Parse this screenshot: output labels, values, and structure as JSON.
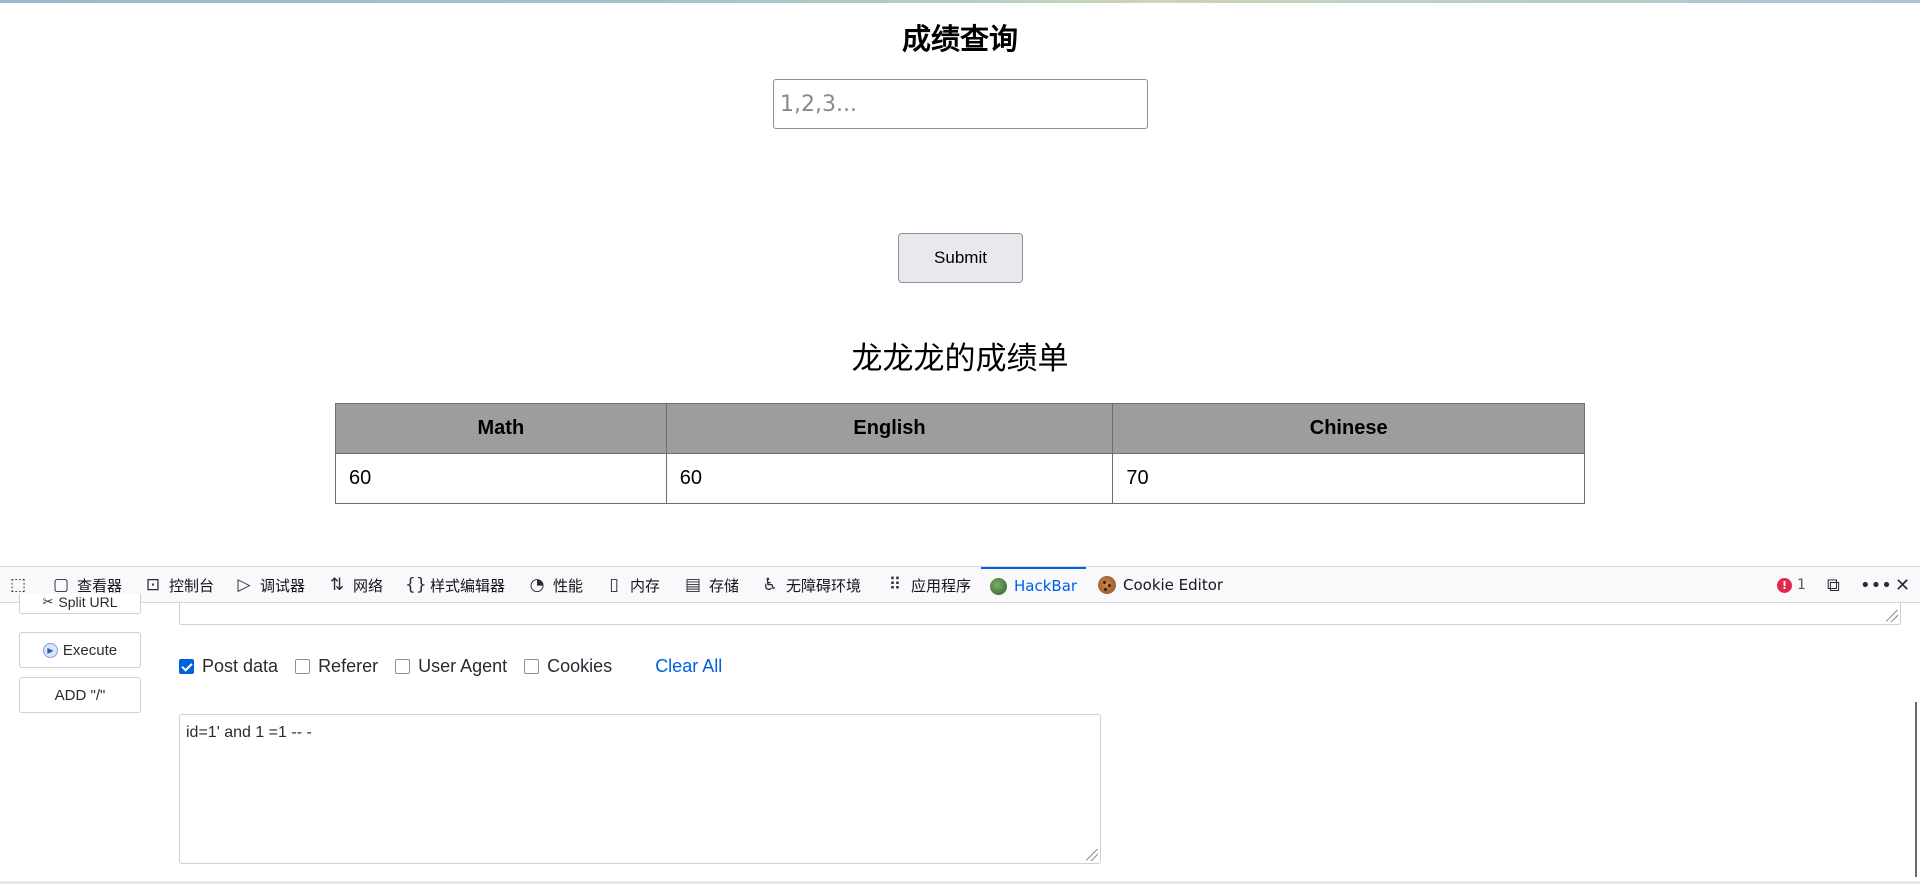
{
  "page": {
    "title": "成绩查询",
    "search": {
      "placeholder": "1,2,3...",
      "value": ""
    },
    "submit_label": "Submit",
    "report_title": "龙龙龙的成绩单",
    "table": {
      "headers": [
        "Math",
        "English",
        "Chinese"
      ],
      "rows": [
        [
          "60",
          "60",
          "70"
        ]
      ]
    }
  },
  "devtools": {
    "tabs": [
      {
        "label": "查看器",
        "icon": "inspector-icon"
      },
      {
        "label": "控制台",
        "icon": "console-icon"
      },
      {
        "label": "调试器",
        "icon": "debugger-icon"
      },
      {
        "label": "网络",
        "icon": "network-icon"
      },
      {
        "label": "样式编辑器",
        "icon": "style-editor-icon"
      },
      {
        "label": "性能",
        "icon": "performance-icon"
      },
      {
        "label": "内存",
        "icon": "memory-icon"
      },
      {
        "label": "存储",
        "icon": "storage-icon"
      },
      {
        "label": "无障碍环境",
        "icon": "accessibility-icon"
      },
      {
        "label": "应用程序",
        "icon": "application-icon"
      },
      {
        "label": "HackBar",
        "icon": "hackbar-icon",
        "active": true
      },
      {
        "label": "Cookie Editor",
        "icon": "cookie-icon"
      }
    ],
    "error_count": "1",
    "accent": "#0061e0",
    "error_color": "#e22850"
  },
  "hackbar": {
    "buttons": {
      "split_url": "Split URL",
      "execute": "Execute",
      "add_slash": "ADD \"/\""
    },
    "options": {
      "post_data": {
        "label": "Post data",
        "checked": true
      },
      "referer": {
        "label": "Referer",
        "checked": false
      },
      "user_agent": {
        "label": "User Agent",
        "checked": false
      },
      "cookies": {
        "label": "Cookies",
        "checked": false
      }
    },
    "clear_all": "Clear All",
    "post_body": "id=1' and 1 =1 -- -"
  }
}
